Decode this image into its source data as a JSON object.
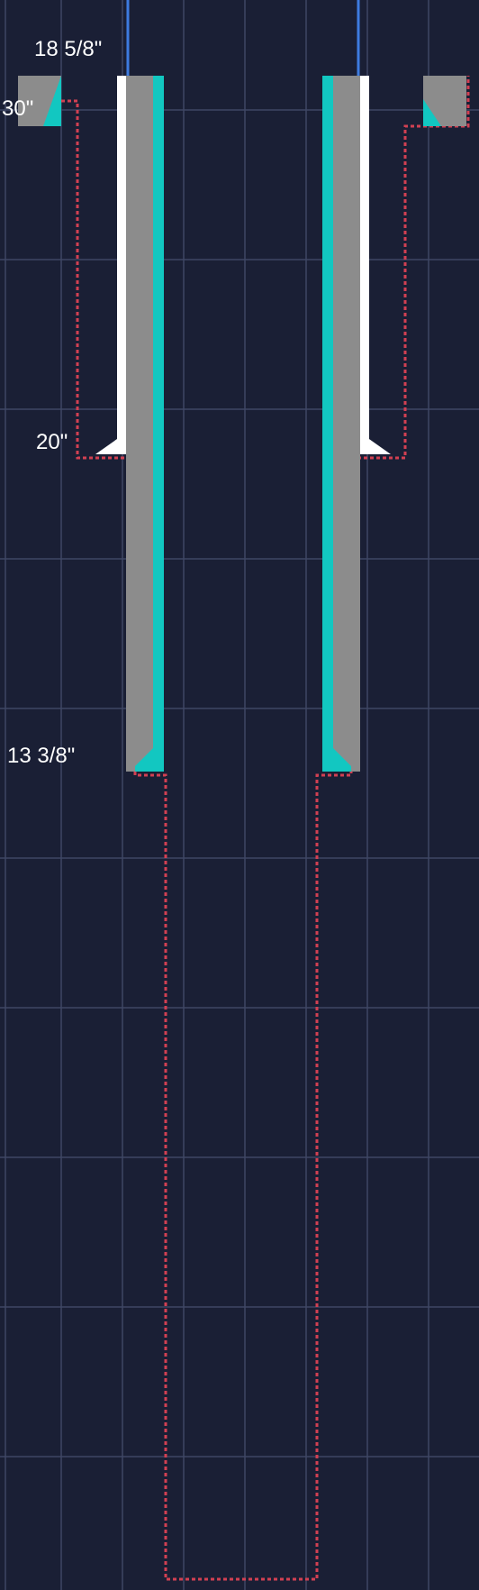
{
  "colors": {
    "background": "#1a1f35",
    "grid": "#3e4664",
    "casing": "#8c8c8c",
    "cement_cyan": "#12c7c1",
    "conductor_white": "#ffffff",
    "drillpipe_blue": "#3d7be0",
    "hole_outline_red": "#d24052"
  },
  "labels": {
    "casing_18_5_8": "18 5/8\"",
    "casing_30": "30\"",
    "casing_20": "20\"",
    "casing_13_3_8": "13 3/8\""
  }
}
